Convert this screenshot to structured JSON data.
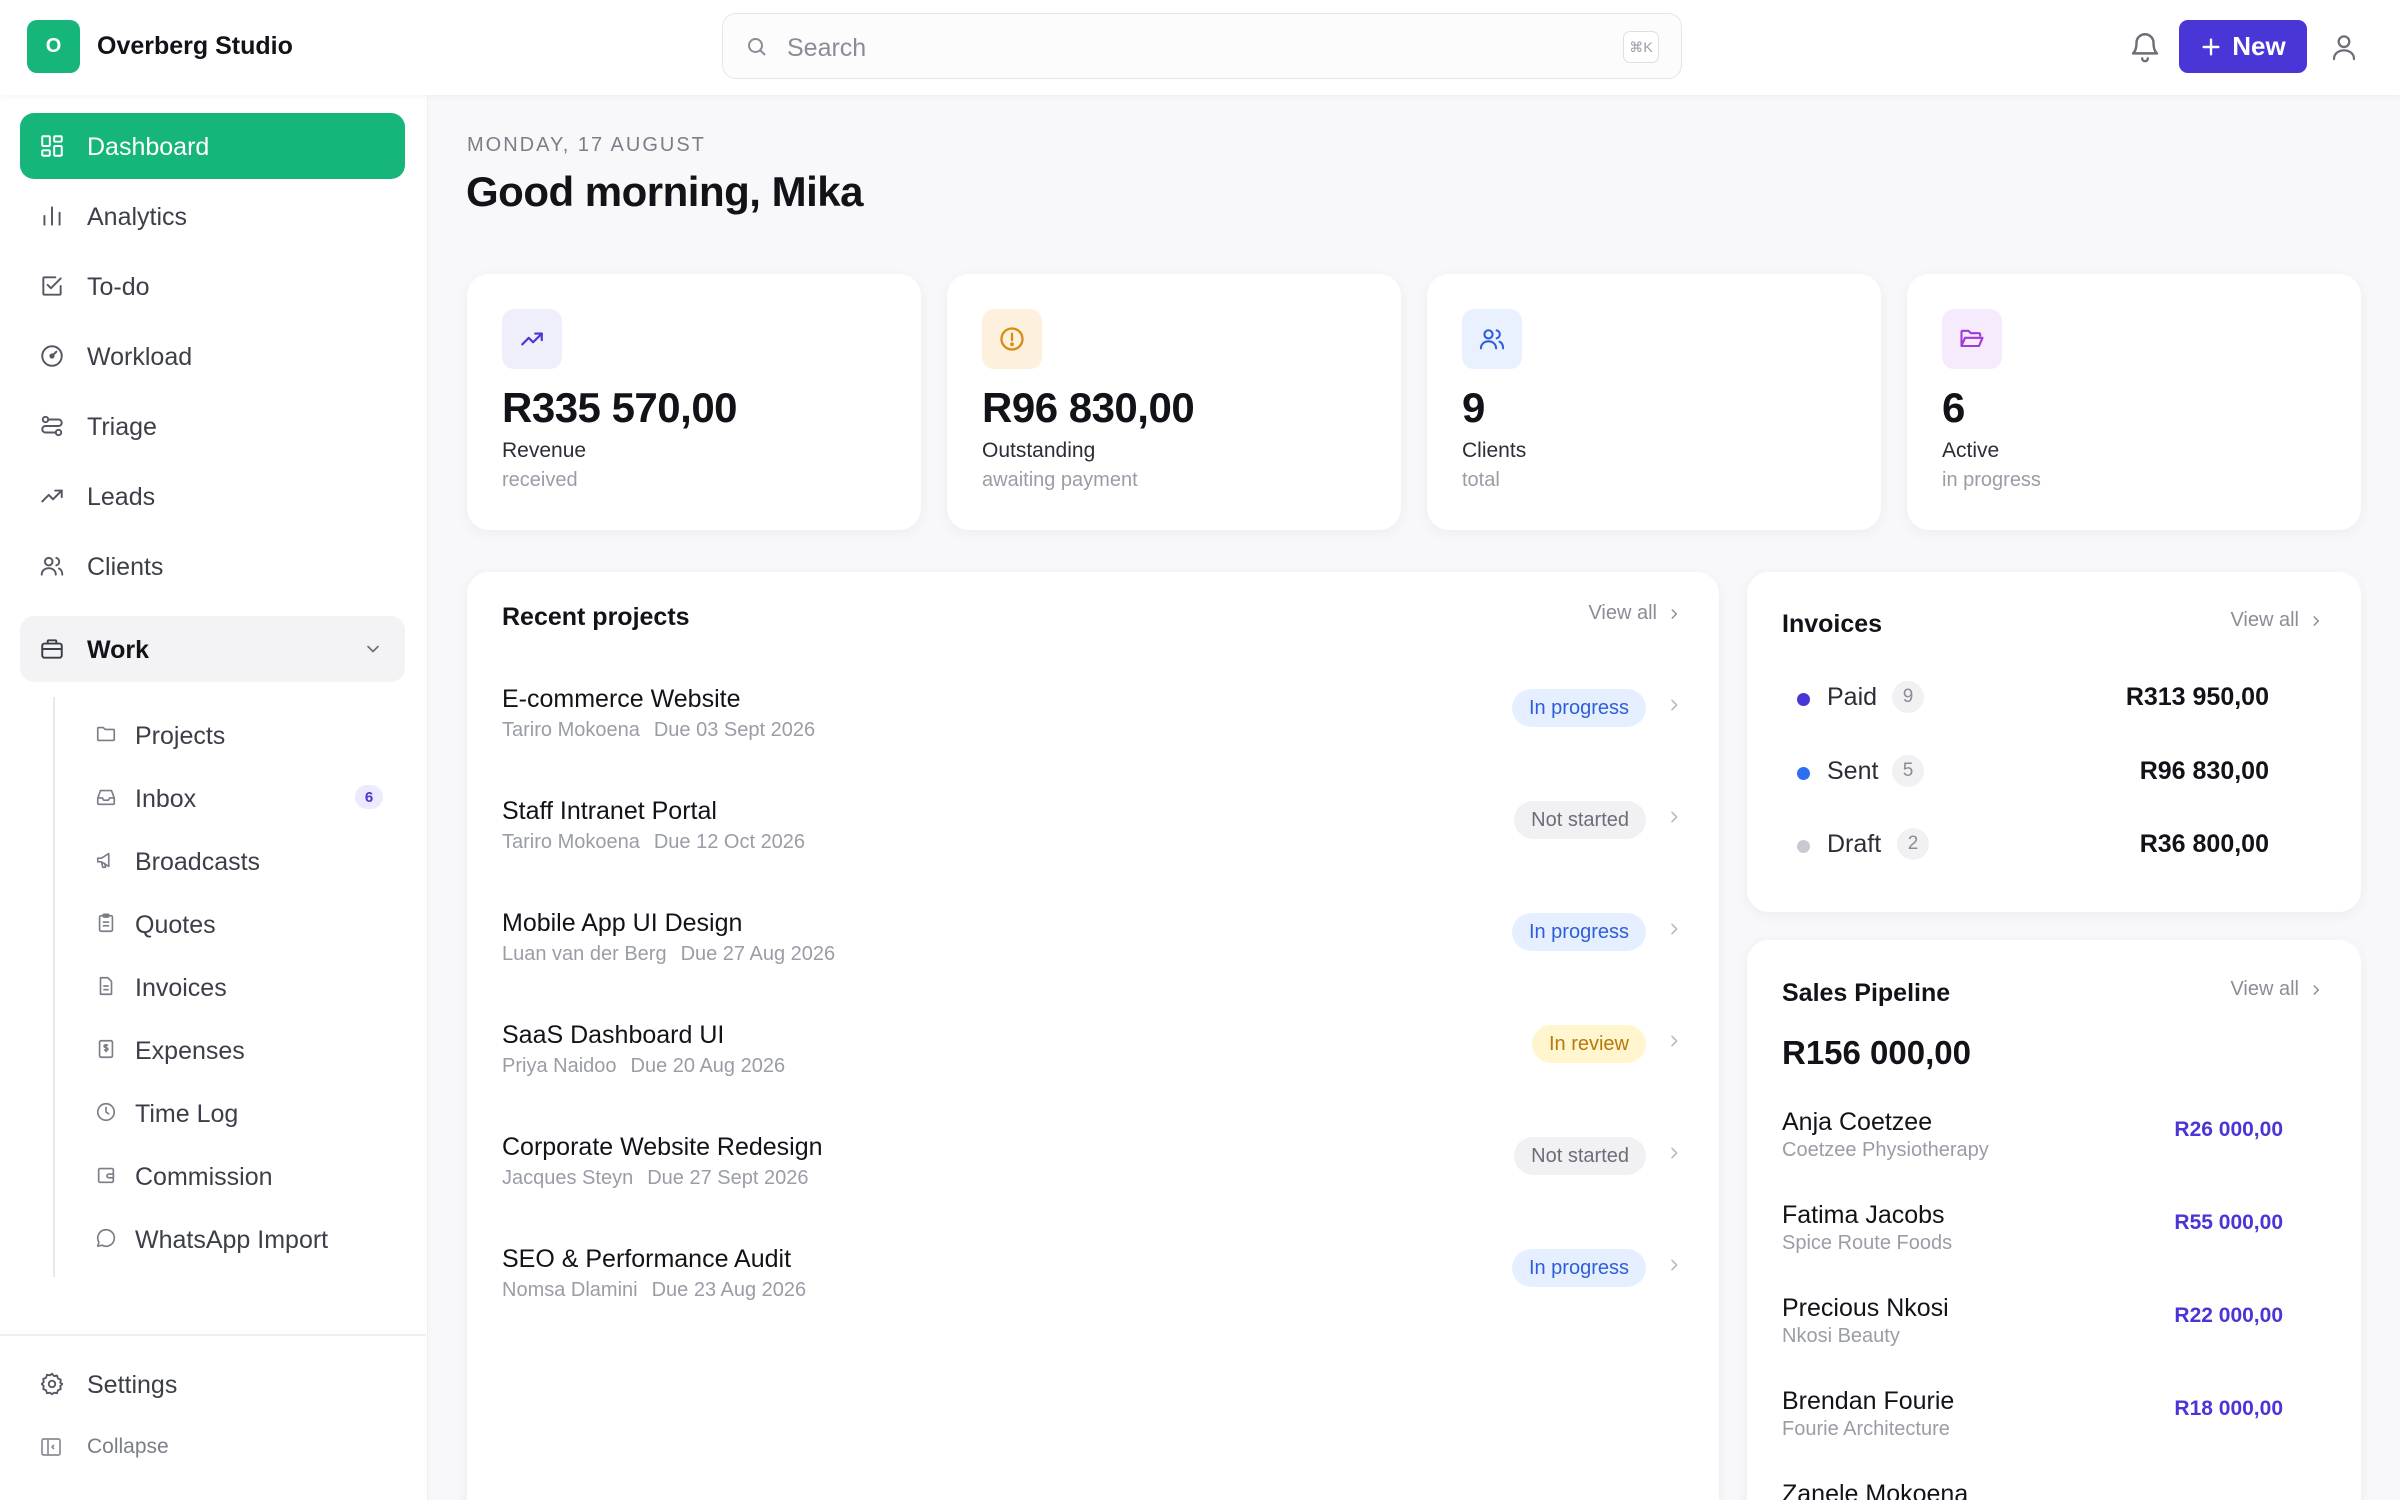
{
  "header": {
    "logo_letter": "O",
    "brand": "Overberg Studio",
    "search_placeholder": "Search",
    "search_shortcut": "⌘K",
    "new_label": "New"
  },
  "sidebar": {
    "items": [
      {
        "label": "Dashboard",
        "icon": "dashboard-icon"
      },
      {
        "label": "Analytics",
        "icon": "analytics-icon"
      },
      {
        "label": "To-do",
        "icon": "todo-icon"
      },
      {
        "label": "Workload",
        "icon": "workload-icon"
      },
      {
        "label": "Triage",
        "icon": "triage-icon"
      },
      {
        "label": "Leads",
        "icon": "leads-icon"
      },
      {
        "label": "Clients",
        "icon": "clients-icon"
      }
    ],
    "group": {
      "label": "Work",
      "icon": "briefcase-icon"
    },
    "sub_items": [
      {
        "label": "Projects",
        "icon": "folder-icon"
      },
      {
        "label": "Inbox",
        "icon": "inbox-icon",
        "count": "6"
      },
      {
        "label": "Broadcasts",
        "icon": "megaphone-icon"
      },
      {
        "label": "Quotes",
        "icon": "clipboard-icon"
      },
      {
        "label": "Invoices",
        "icon": "document-icon"
      },
      {
        "label": "Expenses",
        "icon": "receipt-icon"
      },
      {
        "label": "Time Log",
        "icon": "clock-icon"
      },
      {
        "label": "Commission",
        "icon": "wallet-icon"
      },
      {
        "label": "WhatsApp Import",
        "icon": "chat-icon"
      }
    ],
    "settings_label": "Settings",
    "collapse_label": "Collapse"
  },
  "main": {
    "date": "MONDAY, 17 AUGUST",
    "greeting": "Good morning, Mika",
    "stats": [
      {
        "value": "R335 570,00",
        "label": "Revenue",
        "sub": "received",
        "icon": "trend-up-icon",
        "bg": "#efeefb",
        "fg": "#4a35d6"
      },
      {
        "value": "R96 830,00",
        "label": "Outstanding",
        "sub": "awaiting payment",
        "icon": "alert-circle-icon",
        "bg": "#fdf1de",
        "fg": "#d98b12"
      },
      {
        "value": "9",
        "label": "Clients",
        "sub": "total",
        "icon": "users-icon",
        "bg": "#e9f0fe",
        "fg": "#2d5fd8"
      },
      {
        "value": "6",
        "label": "Active",
        "sub": "in progress",
        "icon": "folder-open-icon",
        "bg": "#f6eafd",
        "fg": "#a23ad6"
      }
    ],
    "recent_projects": {
      "title": "Recent projects",
      "view_all": "View all",
      "rows": [
        {
          "name": "E-commerce Website",
          "client": "Tariro Mokoena",
          "due": "Due 03 Sept 2026",
          "status": "In progress",
          "kind": "progress"
        },
        {
          "name": "Staff Intranet Portal",
          "client": "Tariro Mokoena",
          "due": "Due 12 Oct 2026",
          "status": "Not started",
          "kind": "notstarted"
        },
        {
          "name": "Mobile App UI Design",
          "client": "Luan van der Berg",
          "due": "Due 27 Aug 2026",
          "status": "In progress",
          "kind": "progress"
        },
        {
          "name": "SaaS Dashboard UI",
          "client": "Priya Naidoo",
          "due": "Due 20 Aug 2026",
          "status": "In review",
          "kind": "review"
        },
        {
          "name": "Corporate Website Redesign",
          "client": "Jacques Steyn",
          "due": "Due 27 Sept 2026",
          "status": "Not started",
          "kind": "notstarted"
        },
        {
          "name": "SEO & Performance Audit",
          "client": "Nomsa Dlamini",
          "due": "Due 23 Aug 2026",
          "status": "In progress",
          "kind": "progress"
        }
      ]
    },
    "invoices": {
      "title": "Invoices",
      "view_all": "View all",
      "rows": [
        {
          "label": "Paid",
          "count": "9",
          "amount": "R313 950,00",
          "color": "#4a35d6"
        },
        {
          "label": "Sent",
          "count": "5",
          "amount": "R96 830,00",
          "color": "#2d6ff0"
        },
        {
          "label": "Draft",
          "count": "2",
          "amount": "R36 800,00",
          "color": "#c9cad1"
        }
      ]
    },
    "pipeline": {
      "title": "Sales Pipeline",
      "view_all": "View all",
      "total": "R156 000,00",
      "rows": [
        {
          "name": "Anja Coetzee",
          "company": "Coetzee Physiotherapy",
          "amount": "R26 000,00"
        },
        {
          "name": "Fatima Jacobs",
          "company": "Spice Route Foods",
          "amount": "R55 000,00"
        },
        {
          "name": "Precious Nkosi",
          "company": "Nkosi Beauty",
          "amount": "R22 000,00"
        },
        {
          "name": "Brendan Fourie",
          "company": "Fourie Architecture",
          "amount": "R18 000,00"
        },
        {
          "name": "Zanele Mokoena",
          "company": "",
          "amount": ""
        }
      ]
    }
  }
}
